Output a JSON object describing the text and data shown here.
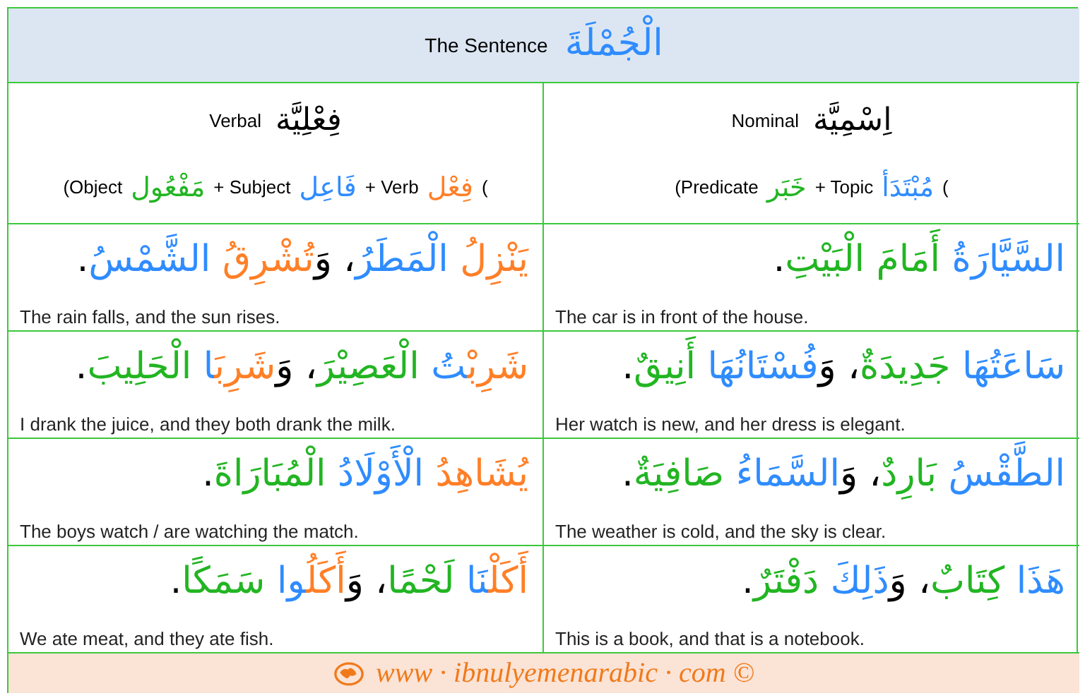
{
  "header": {
    "title": "The Sentence",
    "arabic_title": "الْجُمْلَةَ"
  },
  "columns": [
    {
      "label": "Nominal",
      "arabic": "اِسْمِيَّة",
      "formula": [
        {
          "text": "(",
          "color": "#000000"
        },
        {
          "text": "مُبْتَدَأ",
          "color": "#2f8cff"
        },
        {
          "text": "+ Topic",
          "color": "#000000"
        },
        {
          "text": "خَبَر",
          "color": "#22b522"
        },
        {
          "text": "(Predicate",
          "color": "#000000"
        }
      ]
    },
    {
      "label": "Verbal",
      "arabic": "فِعْلِيَّة",
      "formula": [
        {
          "text": "(",
          "color": "#000000"
        },
        {
          "text": "فِعْل",
          "color": "#ff7f27"
        },
        {
          "text": "+ Verb",
          "color": "#000000"
        },
        {
          "text": "فَاعِل",
          "color": "#2f8cff"
        },
        {
          "text": "+ Subject",
          "color": "#000000"
        },
        {
          "text": "مَفْعُول",
          "color": "#22b522"
        },
        {
          "text": "(Object",
          "color": "#000000"
        }
      ]
    }
  ],
  "rows": [
    {
      "verbal": {
        "arabic": [
          {
            "text": "يَنْزِلُ",
            "color": "#ff7f27"
          },
          {
            "text": " الْمَطَرُ",
            "color": "#2f8cff"
          },
          {
            "text": "، وَ",
            "color": "#000000"
          },
          {
            "text": "تُشْرِقُ",
            "color": "#ff7f27"
          },
          {
            "text": " الشَّمْسُ",
            "color": "#2f8cff"
          },
          {
            "text": ".",
            "color": "#000000"
          }
        ],
        "english": "The rain falls, and the sun rises."
      },
      "nominal": {
        "arabic": [
          {
            "text": "السَّيَّارَةُ",
            "color": "#2f8cff"
          },
          {
            "text": " أَمَامَ الْبَيْتِ",
            "color": "#22b522"
          },
          {
            "text": ".",
            "color": "#000000"
          }
        ],
        "english": "The car is in front of the house."
      }
    },
    {
      "verbal": {
        "arabic": [
          {
            "text": "شَرِبْ",
            "color": "#ff7f27"
          },
          {
            "text": "تُ",
            "color": "#2f8cff"
          },
          {
            "text": " الْعَصِيْرَ",
            "color": "#22b522"
          },
          {
            "text": "، وَ",
            "color": "#000000"
          },
          {
            "text": "شَرِبَ",
            "color": "#ff7f27"
          },
          {
            "text": "ا",
            "color": "#2f8cff"
          },
          {
            "text": " الْحَلِيبَ",
            "color": "#22b522"
          },
          {
            "text": ".",
            "color": "#000000"
          }
        ],
        "english": "I drank the juice, and they both drank the milk."
      },
      "nominal": {
        "arabic": [
          {
            "text": "سَاعَتُهَا",
            "color": "#2f8cff"
          },
          {
            "text": " جَدِيدَةٌ",
            "color": "#22b522"
          },
          {
            "text": "، وَ",
            "color": "#000000"
          },
          {
            "text": "فُسْتَانُهَا",
            "color": "#2f8cff"
          },
          {
            "text": " أَنِيقٌ",
            "color": "#22b522"
          },
          {
            "text": ".",
            "color": "#000000"
          }
        ],
        "english": "Her watch is new, and her dress is elegant."
      }
    },
    {
      "verbal": {
        "arabic": [
          {
            "text": "يُشَاهِدُ",
            "color": "#ff7f27"
          },
          {
            "text": " الْأَوْلَادُ",
            "color": "#2f8cff"
          },
          {
            "text": " الْمُبَارَاةَ",
            "color": "#22b522"
          },
          {
            "text": ".",
            "color": "#000000"
          }
        ],
        "english": "The boys watch / are watching the match."
      },
      "nominal": {
        "arabic": [
          {
            "text": "الطَّقْسُ",
            "color": "#2f8cff"
          },
          {
            "text": " بَارِدٌ",
            "color": "#22b522"
          },
          {
            "text": "، وَ",
            "color": "#000000"
          },
          {
            "text": "السَّمَاءُ",
            "color": "#2f8cff"
          },
          {
            "text": " صَافِيَةٌ",
            "color": "#22b522"
          },
          {
            "text": ".",
            "color": "#000000"
          }
        ],
        "english": "The weather is cold, and the sky is clear."
      }
    },
    {
      "verbal": {
        "arabic": [
          {
            "text": "أَكَلْ",
            "color": "#ff7f27"
          },
          {
            "text": "نَا",
            "color": "#2f8cff"
          },
          {
            "text": " لَحْمًا",
            "color": "#22b522"
          },
          {
            "text": "، وَ",
            "color": "#000000"
          },
          {
            "text": "أَكَلُ",
            "color": "#ff7f27"
          },
          {
            "text": "وا",
            "color": "#2f8cff"
          },
          {
            "text": " سَمَكًا",
            "color": "#22b522"
          },
          {
            "text": ".",
            "color": "#000000"
          }
        ],
        "english": "We ate meat, and they ate fish."
      },
      "nominal": {
        "arabic": [
          {
            "text": "هَذَا",
            "color": "#2f8cff"
          },
          {
            "text": " كِتَابٌ",
            "color": "#22b522"
          },
          {
            "text": "، وَ",
            "color": "#000000"
          },
          {
            "text": "ذَلِكَ",
            "color": "#2f8cff"
          },
          {
            "text": " دَفْتَرٌ",
            "color": "#22b522"
          },
          {
            "text": ".",
            "color": "#000000"
          }
        ],
        "english": "This is a book, and that is a notebook."
      }
    }
  ],
  "footer": {
    "text": "www · ibnulyemenarabic · com ©"
  }
}
